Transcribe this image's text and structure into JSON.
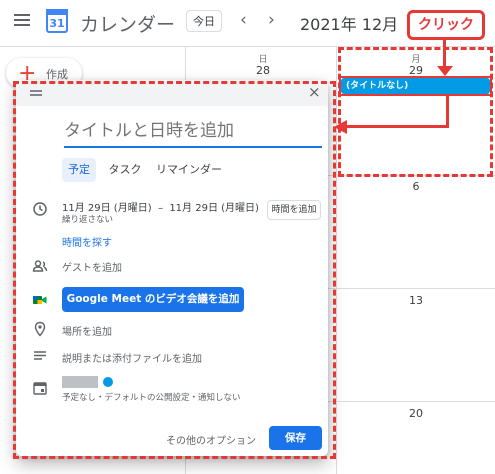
{
  "header": {
    "app_title": "カレンダー",
    "logo_text": "31",
    "today_label": "今日",
    "prev_icon": "‹",
    "next_icon": "›",
    "month_label": "2021年 12月"
  },
  "create_button": {
    "label": "作成"
  },
  "calendar": {
    "columns": [
      {
        "weekday": "日",
        "day": "28"
      },
      {
        "weekday": "月",
        "day": "29"
      }
    ],
    "week_numbers": [
      "6",
      "13",
      "20"
    ],
    "event_chip": "(タイトルなし)"
  },
  "dialog": {
    "title_placeholder": "タイトルと日時を追加",
    "tabs": [
      "予定",
      "タスク",
      "リマインダー"
    ],
    "date_range": "11月 29日 (月曜日)  –  11月 29日 (月曜日)",
    "repeat": "繰り返さない",
    "add_time_label": "時間を追加",
    "find_time": "時間を探す",
    "add_guests": "ゲストを追加",
    "meet_button": "Google Meet のビデオ会議を追加",
    "add_location": "場所を追加",
    "add_description": "説明または添付ファイルを追加",
    "calendar_settings": "予定なし・デフォルトの公開設定・通知しない",
    "more_options": "その他のオプション",
    "save_label": "保存"
  },
  "annotation": {
    "callout_label": "クリック"
  },
  "colors": {
    "accent": "#1a73e8",
    "event": "#039be5",
    "annotation_red": "#e53935"
  }
}
